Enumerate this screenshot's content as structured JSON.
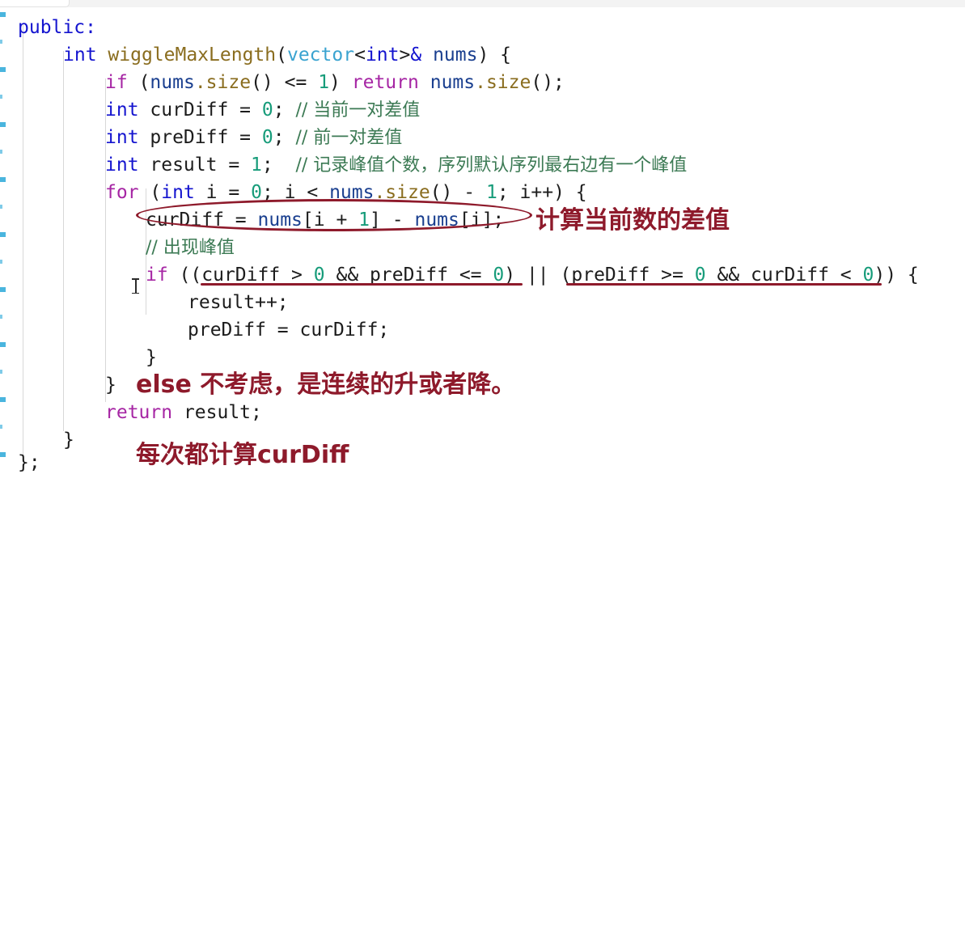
{
  "window": {
    "tab_label": ""
  },
  "editor": {
    "language": "cpp",
    "background": "#ffffff",
    "colors": {
      "keyword": "#a626a4",
      "type": "#1414cf",
      "function": "#8a6d1f",
      "class": "#3aa3d0",
      "variable": "#1a3f8f",
      "number": "#179c7a",
      "comment": "#3c7a54",
      "annotation_red": "#8e1a2b",
      "gutter_linenumber": "#2aa8d8"
    }
  },
  "code": {
    "lines": [
      {
        "indent": 0,
        "text": "public:"
      },
      {
        "indent": 1,
        "text": "int wiggleMaxLength(vector<int>& nums) {"
      },
      {
        "indent": 2,
        "text": "if (nums.size() <= 1) return nums.size();"
      },
      {
        "indent": 2,
        "text": "int curDiff = 0; // 当前一对差值"
      },
      {
        "indent": 2,
        "text": "int preDiff = 0; // 前一对差值"
      },
      {
        "indent": 2,
        "text": "int result = 1;  // 记录峰值个数，序列默认序列最右边有一个峰值"
      },
      {
        "indent": 2,
        "text": "for (int i = 0; i < nums.size() - 1; i++) {"
      },
      {
        "indent": 3,
        "text": "curDiff = nums[i + 1] - nums[i];"
      },
      {
        "indent": 3,
        "text": "// 出现峰值"
      },
      {
        "indent": 3,
        "text": "if ((curDiff > 0 && preDiff <= 0) || (preDiff >= 0 && curDiff < 0)) {"
      },
      {
        "indent": 4,
        "text": "result++;"
      },
      {
        "indent": 4,
        "text": "preDiff = curDiff;"
      },
      {
        "indent": 3,
        "text": "}"
      },
      {
        "indent": 2,
        "text": "}"
      },
      {
        "indent": 2,
        "text": "return result;"
      },
      {
        "indent": 1,
        "text": "}"
      },
      {
        "indent": 0,
        "text": "};"
      }
    ],
    "tokens": {
      "public": "public:",
      "int": "int",
      "fn_name": "wiggleMaxLength",
      "vector": "vector",
      "amp_nums": "& nums",
      "if": "if",
      "for": "for",
      "return": "return",
      "nums": "nums",
      "size": ".size",
      "curDiff": "curDiff",
      "preDiff": "preDiff",
      "result": "result",
      "zero": "0",
      "one": "1"
    },
    "comments": {
      "cur_diff": "// 当前一对差值",
      "pre_diff": "// 前一对差值",
      "result": "// 记录峰值个数，序列默认序列最右边有一个峰值",
      "peak": "// 出现峰值"
    }
  },
  "annotations": [
    {
      "id": "calc-current-diff",
      "text": "计算当前数的差值",
      "color": "#8e1a2b",
      "kind": "text"
    },
    {
      "id": "else-note",
      "text": "else 不考虑，是连续的升或者降。",
      "color": "#8e1a2b",
      "kind": "text"
    },
    {
      "id": "always-calc-curdiff",
      "text": "每次都计算curDiff",
      "color": "#8e1a2b",
      "kind": "text"
    },
    {
      "id": "ellipse-curdiff-line",
      "kind": "ellipse",
      "color": "#8e1a2b"
    },
    {
      "id": "underline-cond-1",
      "kind": "underline",
      "color": "#8e1a2b"
    },
    {
      "id": "underline-cond-2",
      "kind": "underline",
      "color": "#8e1a2b"
    }
  ]
}
